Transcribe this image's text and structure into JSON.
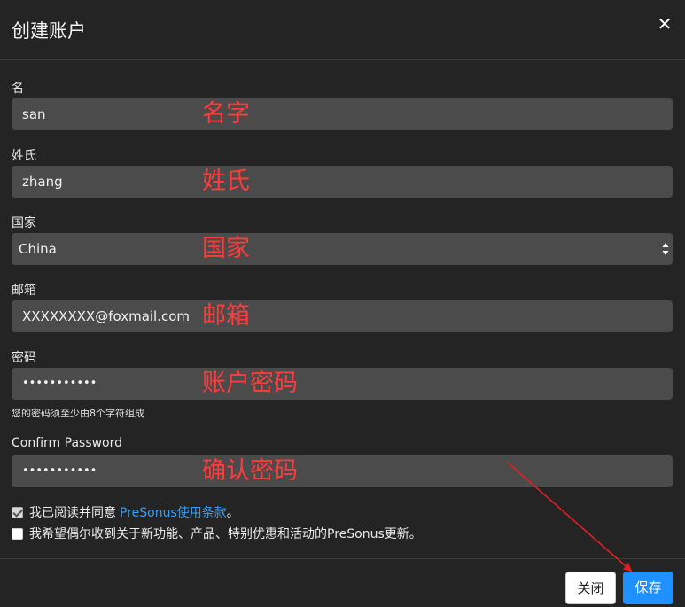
{
  "dialog": {
    "title": "创建账户",
    "close_icon": "close-icon"
  },
  "form": {
    "first_name": {
      "label": "名",
      "value": "san",
      "annotation": "名字"
    },
    "last_name": {
      "label": "姓氏",
      "value": "zhang",
      "annotation": "姓氏"
    },
    "country": {
      "label": "国家",
      "value": "China",
      "annotation": "国家"
    },
    "email": {
      "label": "邮箱",
      "value": "XXXXXXXX@foxmail.com",
      "annotation": "邮箱"
    },
    "password": {
      "label": "密码",
      "value": "•••••••••••",
      "annotation": "账户密码",
      "help": "您的密码须至少由8个字符组成"
    },
    "confirm_password": {
      "label": "Confirm Password",
      "value": "•••••••••••",
      "annotation": "确认密码"
    }
  },
  "agreements": {
    "terms": {
      "checked": true,
      "text": "我已阅读并同意",
      "link": "PreSonus使用条款",
      "suffix": "。"
    },
    "newsletter": {
      "checked": false,
      "text": "我希望偶尔收到关于新功能、产品、特别优惠和活动的PreSonus更新。"
    }
  },
  "footer": {
    "close_label": "关闭",
    "save_label": "保存"
  },
  "colors": {
    "annotation": "#ff3b3b",
    "primary": "#1e90ff",
    "link": "#3f9cf0"
  }
}
